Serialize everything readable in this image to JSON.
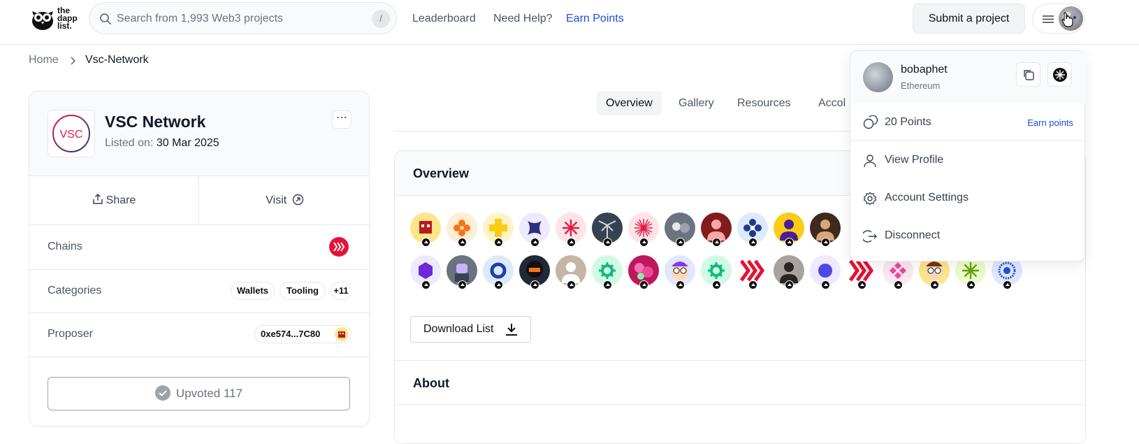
{
  "header": {
    "logo_text": [
      "the",
      "dapp",
      "list."
    ],
    "search_placeholder": "Search from 1,993 Web3 projects",
    "search_shortcut": "/",
    "nav": [
      "Leaderboard",
      "Need Help?",
      "Earn Points"
    ],
    "submit_label": "Submit a project"
  },
  "breadcrumb": {
    "home": "Home",
    "current": "Vsc-Network"
  },
  "project": {
    "name": "VSC Network",
    "logo_text": "VSC",
    "listed_label": "Listed on:",
    "listed_date": "30 Mar 2025",
    "share_label": "Share",
    "visit_label": "Visit",
    "chains_label": "Chains",
    "categories_label": "Categories",
    "categories": [
      "Wallets",
      "Tooling",
      "+11"
    ],
    "proposer_label": "Proposer",
    "proposer_address": "0xe574...7C80",
    "upvote_label": "Upvoted 117"
  },
  "tabs": [
    "Overview",
    "Gallery",
    "Resources",
    "Accol"
  ],
  "overview": {
    "title": "Overview",
    "download_label": "Download List",
    "about_title": "About",
    "voters_row1": [
      {
        "icon": "pixel-character",
        "bg": "#fde68a",
        "fg": "#b91c1c"
      },
      {
        "icon": "clover",
        "bg": "#ffedd5",
        "fg": "#f97316"
      },
      {
        "icon": "plus",
        "bg": "#fef3c7",
        "fg": "#facc15"
      },
      {
        "icon": "x-shape",
        "bg": "#ede9fe",
        "fg": "#312e81"
      },
      {
        "icon": "asterisk",
        "bg": "#ffe4e6",
        "fg": "#e11d48"
      },
      {
        "icon": "palm-photo",
        "bg": "#374151",
        "fg": "#d1d5db"
      },
      {
        "icon": "starburst",
        "bg": "#ffe4e6",
        "fg": "#e11d48"
      },
      {
        "icon": "cat-photo",
        "bg": "#6b7280",
        "fg": "#e5e7eb"
      },
      {
        "icon": "person-photo",
        "bg": "#7f1d1d",
        "fg": "#fca5a5"
      },
      {
        "icon": "flower",
        "bg": "#dbeafe",
        "fg": "#1e3a8a"
      },
      {
        "icon": "person-photo",
        "bg": "#facc15",
        "fg": "#4c1d95"
      },
      {
        "icon": "person-photo",
        "bg": "#3f2a1d",
        "fg": "#d6a77a"
      }
    ],
    "voters_row2": [
      {
        "icon": "hexagon",
        "bg": "#ede9fe",
        "fg": "#6d28d9"
      },
      {
        "icon": "robot",
        "bg": "#6b7280",
        "fg": "#c4b5fd"
      },
      {
        "icon": "ring",
        "bg": "#dbeafe",
        "fg": "#1e40af"
      },
      {
        "icon": "helmet",
        "bg": "#1f2937",
        "fg": "#f97316"
      },
      {
        "icon": "person-photo",
        "bg": "#c4b5a5",
        "fg": "#ffffff"
      },
      {
        "icon": "gear",
        "bg": "#d1fae5",
        "fg": "#10b981"
      },
      {
        "icon": "roses",
        "bg": "#be185d",
        "fg": "#86efac"
      },
      {
        "icon": "cartoon",
        "bg": "#e0e7ff",
        "fg": "#7c3aed"
      },
      {
        "icon": "gear",
        "bg": "#d1fae5",
        "fg": "#10b981"
      },
      {
        "icon": "hive",
        "bg": "#ffffff",
        "fg": "#e31337"
      },
      {
        "icon": "person-photo",
        "bg": "#a8a29e",
        "fg": "#292524"
      },
      {
        "icon": "dot",
        "bg": "#ede9fe",
        "fg": "#4f46e5"
      },
      {
        "icon": "hive",
        "bg": "#ffffff",
        "fg": "#e31337"
      },
      {
        "icon": "diamond",
        "bg": "#fce7f3",
        "fg": "#ec4899"
      },
      {
        "icon": "cartoon",
        "bg": "#fde68a",
        "fg": "#78350f"
      },
      {
        "icon": "asterisk",
        "bg": "#ecfccb",
        "fg": "#65a30d"
      },
      {
        "icon": "sunburst",
        "bg": "#e0e7ff",
        "fg": "#1d4ed8"
      }
    ]
  },
  "account_menu": {
    "username": "bobaphet",
    "chain": "Ethereum",
    "points": "20 Points",
    "earn_link": "Earn points",
    "items": [
      "View Profile",
      "Account Settings",
      "Disconnect"
    ]
  },
  "colors": {
    "accent": "#1d4ed8",
    "hive_red": "#e31337",
    "border": "#e5e7eb"
  }
}
